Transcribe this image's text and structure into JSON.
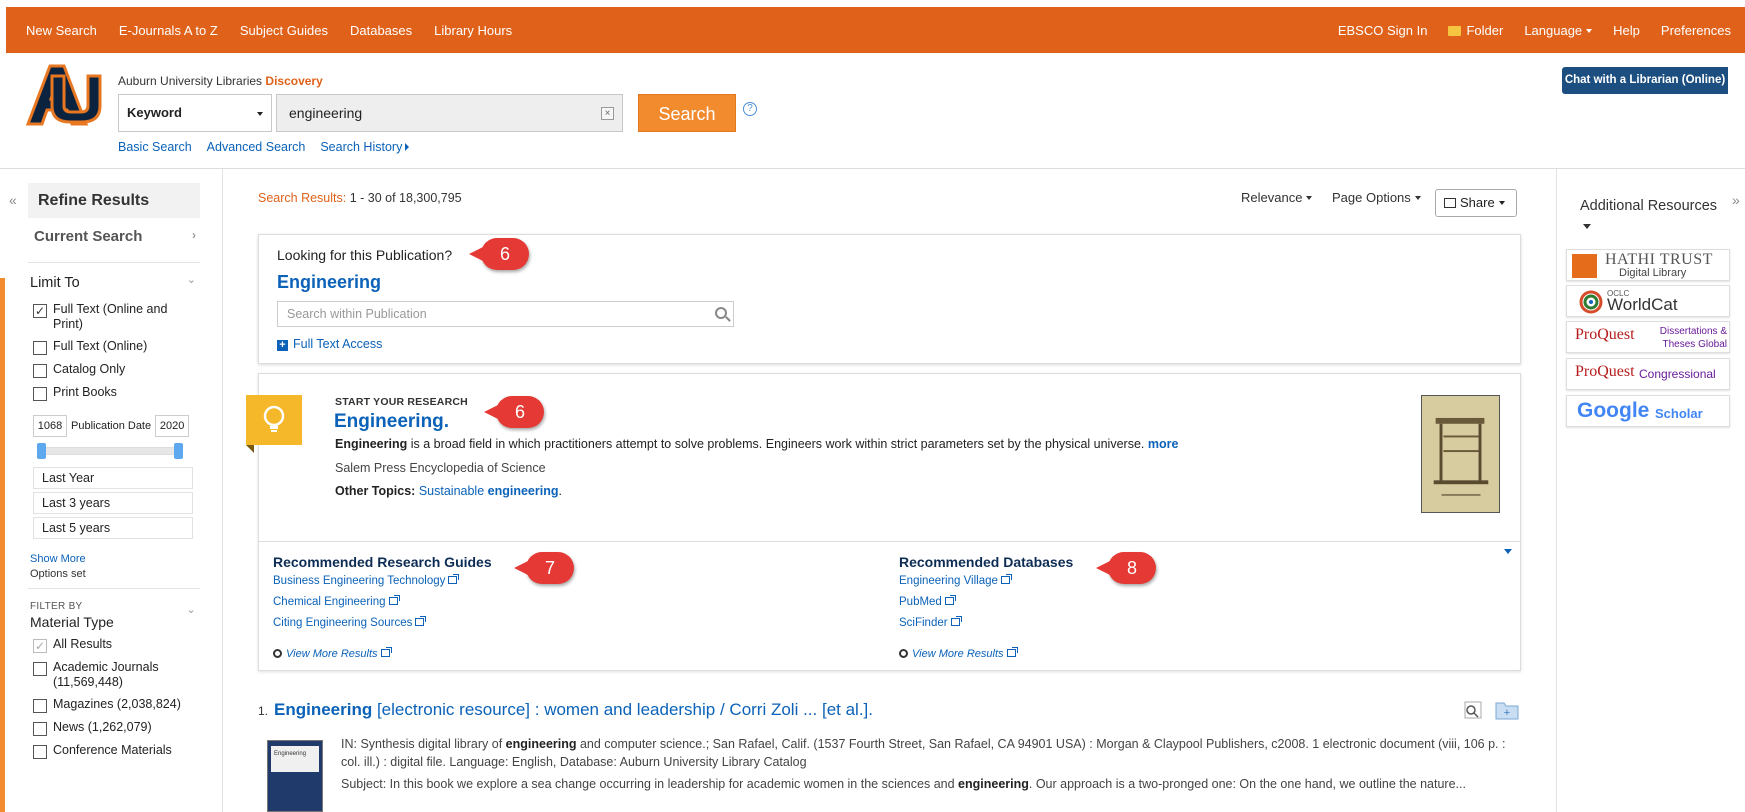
{
  "topbar": {
    "nav": [
      "New Search",
      "E-Journals A to Z",
      "Subject Guides",
      "Databases",
      "Library Hours"
    ],
    "sign_in": "EBSCO Sign In",
    "folder": "Folder",
    "language": "Language",
    "help": "Help",
    "preferences": "Preferences",
    "color": "#e0621a"
  },
  "header": {
    "logo_text": "AU",
    "brand_prefix": "Auburn University Libraries",
    "brand_name": "Discovery",
    "field_select": "Keyword",
    "search_value": "engineering",
    "search_button": "Search",
    "help_glyph": "?",
    "links": [
      "Basic Search",
      "Advanced Search",
      "Search History"
    ],
    "chat_label": "Chat with a Librarian (Online)"
  },
  "sidebar": {
    "refine_title": "Refine Results",
    "current_search": "Current Search",
    "limit_to": "Limit To",
    "limits": [
      {
        "label": "Full Text (Online and Print)",
        "checked": true
      },
      {
        "label": "Full Text (Online)",
        "checked": false
      },
      {
        "label": "Catalog Only",
        "checked": false
      },
      {
        "label": "Print Books",
        "checked": false
      }
    ],
    "pub_from": "1068",
    "pub_label": "Publication Date",
    "pub_to": "2020",
    "ranges": [
      "Last Year",
      "Last 3 years",
      "Last 5 years"
    ],
    "show_more": "Show More",
    "options_set": "Options set",
    "filter_by": "FILTER BY",
    "material_type": "Material Type",
    "materials": [
      {
        "label": "All Results",
        "checked": true,
        "disabled": true
      },
      {
        "label": "Academic Journals (11,569,448)",
        "checked": false
      },
      {
        "label": "Magazines (2,038,824)",
        "checked": false
      },
      {
        "label": "News (1,262,079)",
        "checked": false
      },
      {
        "label": "Conference Materials",
        "checked": false
      }
    ]
  },
  "results_header": {
    "label": "Search Results:",
    "range": "1 - 30 of 18,300,795",
    "relevance": "Relevance",
    "page_options": "Page Options",
    "share": "Share"
  },
  "publication": {
    "question": "Looking for this Publication?",
    "title": "Engineering",
    "search_placeholder": "Search within Publication",
    "full_text": "Full Text Access"
  },
  "research": {
    "kicker": "START YOUR RESEARCH",
    "title": "Engineering.",
    "desc_bold": "Engineering",
    "desc_rest": " is a broad field in which practitioners attempt to solve problems. Engineers work within strict parameters set by the physical universe. ",
    "more": "more",
    "source": "Salem Press Encyclopedia of Science",
    "other_label": "Other Topics:",
    "other_link_a": "Sustainable ",
    "other_link_b": "engineering",
    "other_tail": "."
  },
  "guides": {
    "title": "Recommended Research Guides",
    "items": [
      "Business Engineering Technology",
      "Chemical Engineering",
      "Citing Engineering Sources"
    ],
    "view_more": "View More Results"
  },
  "databases": {
    "title": "Recommended Databases",
    "items": [
      "Engineering Village",
      "PubMed",
      "SciFinder"
    ],
    "view_more": "View More Results"
  },
  "callouts": [
    "6",
    "6",
    "7",
    "8"
  ],
  "result1": {
    "number": "1.",
    "title_bold": "Engineering",
    "title_rest": " [electronic resource] : women and leadership / Corri Zoli ... [et al.].",
    "in_a": "IN: Synthesis digital library of ",
    "in_b": "engineering",
    "in_c": " and computer science.; San Rafael, Calif. (1537 Fourth Street, San Rafael, CA 94901 USA) : Morgan & Claypool Publishers, c2008. 1 electronic document (viii, 106 p. : col. ill.) : digital file. Language: English, Database: Auburn University Library Catalog",
    "subj_a": "Subject: In this book we explore a sea change occurring in leadership for academic women in the sciences and ",
    "subj_b": "engineering",
    "subj_c": ". Our approach is a two-pronged one: On the one hand, we outline the nature...",
    "book_title": "Engineering"
  },
  "right_panel": {
    "title": "Additional Resources",
    "resources": [
      {
        "name": "HATHI TRUST",
        "sub": "Digital Library"
      },
      {
        "name": "WorldCat",
        "sub": "OCLC"
      },
      {
        "name": "ProQuest",
        "sub": "Dissertations & Theses Global"
      },
      {
        "name": "ProQuest",
        "sub": "Congressional"
      },
      {
        "name": "Google",
        "sub": "Scholar"
      }
    ]
  }
}
